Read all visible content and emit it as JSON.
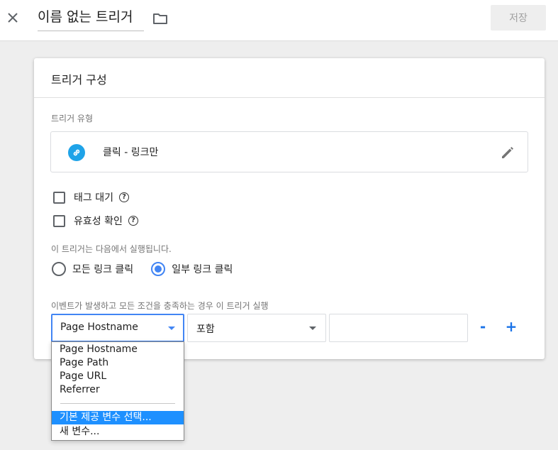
{
  "topbar": {
    "title": "이름 없는 트리거",
    "save_label": "저장"
  },
  "card": {
    "title": "트리거 구성",
    "trigger_type_label": "트리거 유형",
    "trigger_type": "클릭 - 링크만",
    "options": [
      {
        "label": "태그 대기",
        "checked": false
      },
      {
        "label": "유효성 확인",
        "checked": false
      }
    ],
    "fires_on_label": "이 트리거는 다음에서 실행됩니다.",
    "fires_on": [
      {
        "label": "모든 링크 클릭",
        "selected": false
      },
      {
        "label": "일부 링크 클릭",
        "selected": true
      }
    ],
    "condition_label": "이벤트가 발생하고 모든 조건을 충족하는 경우 이 트리거 실행",
    "condition": {
      "variable": "Page Hostname",
      "operator": "포함",
      "value": "",
      "remove_label": "-",
      "add_label": "+"
    }
  },
  "dropdown": {
    "items": [
      "Page Hostname",
      "Page Path",
      "Page URL",
      "Referrer"
    ],
    "builtin_label": "기본 제공 변수 선택...",
    "new_label": "새 변수..."
  },
  "colors": {
    "accent": "#4285f4",
    "link_icon_bg": "#1fa3e8",
    "highlight": "#1e90ff"
  }
}
